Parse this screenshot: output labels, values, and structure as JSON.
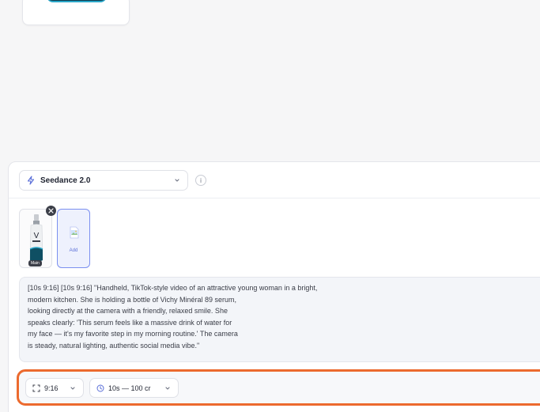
{
  "model_selector": {
    "value": "Seedance 2.0",
    "icon": "bolt-icon"
  },
  "info_button": {
    "label": "i"
  },
  "reference_images": [
    {
      "tag": "Main",
      "icon": "serum-bottle-thumbnail"
    }
  ],
  "add_tile": {
    "label": "Add",
    "icon": "image-add-icon"
  },
  "prompt": {
    "lines": [
      "[10s 9:16] [10s 9:16] \"Handheld, TikTok-style video of an attractive young woman in a bright,",
      "modern kitchen. She is holding a bottle of Vichy Minéral 89 serum,",
      "looking directly at the camera with a friendly, relaxed smile. She",
      "speaks clearly: 'This serum feels like a massive drink of water for",
      "my face — it's my favorite step in my morning routine.' The camera",
      "is steady, natural lighting, authentic social media vibe.\""
    ]
  },
  "settings": {
    "aspect_ratio": "9:16",
    "duration": "10s — 100 cr"
  },
  "colors": {
    "accent_outline": "#ec6a2e",
    "add_tile_border": "#7b8ff0",
    "icon_accent": "#5b6fd8"
  }
}
